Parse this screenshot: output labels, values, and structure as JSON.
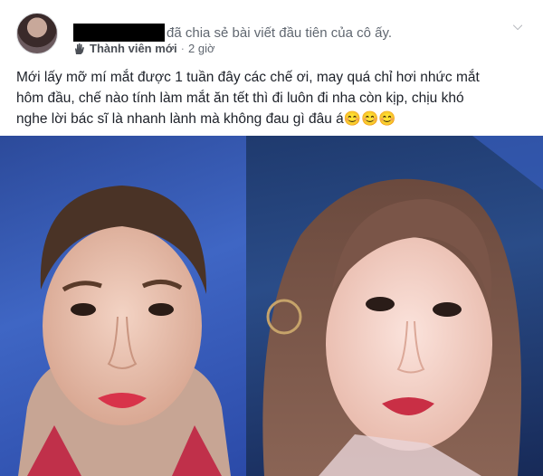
{
  "post": {
    "header_text": "đã chia sẻ bài viết đầu tiên của cô ấy.",
    "badge_label": "Thành viên mới",
    "separator": "·",
    "time": "2 giờ",
    "body_lines": [
      "Mới lấy mỡ mí mắt được 1 tuần đây các chế ơi, may quá chỉ hơi nhức mắt",
      "hôm đầu, chế nào tính làm mắt ăn tết thì đi luôn đi nha còn kịp, chịu khó",
      "nghe lời bác sĩ là nhanh lành mà không đau gì đâu á"
    ],
    "emojis": "😊😊😊"
  },
  "icons": {
    "avatar": "avatar-image",
    "badge": "waving-hand-icon",
    "menu": "chevron-down-icon"
  },
  "colors": {
    "text_primary": "#1d2129",
    "text_secondary": "#606770",
    "photo_left_bg": "#3f66c4",
    "photo_right_bg": "#2a4c88"
  }
}
